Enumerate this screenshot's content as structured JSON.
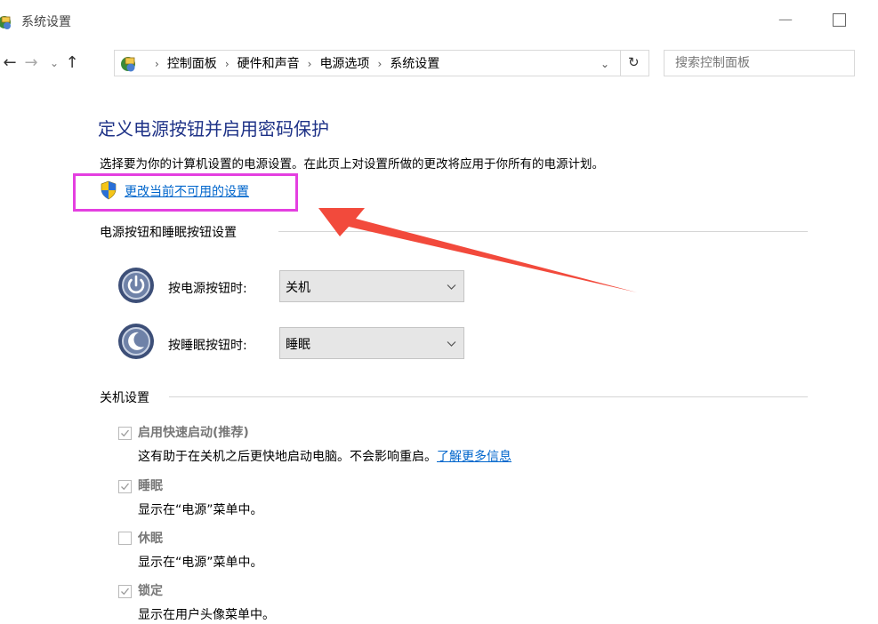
{
  "window": {
    "title": "系统设置",
    "minimize_symbol": "—"
  },
  "nav": {
    "back_icon": "←",
    "forward_icon": "→",
    "recent_icon": "⌄",
    "up_icon": "↑",
    "breadcrumbs": [
      "控制面板",
      "硬件和声音",
      "电源选项",
      "系统设置"
    ],
    "separator": "›",
    "dropdown_icon": "⌄",
    "refresh_icon": "↻",
    "search_placeholder": "搜索控制面板"
  },
  "main": {
    "title": "定义电源按钮并启用密码保护",
    "description": "选择要为你的计算机设置的电源设置。在此页上对设置所做的更改将应用于你所有的电源计划。",
    "change_link": "更改当前不可用的设置",
    "highlight_color": "#e43fe0",
    "arrow_color": "#f24a3c"
  },
  "power_section": {
    "heading": "电源按钮和睡眠按钮设置",
    "rows": [
      {
        "label": "按电源按钮时:",
        "value": "关机",
        "icon": "power-icon"
      },
      {
        "label": "按睡眠按钮时:",
        "value": "睡眠",
        "icon": "sleep-icon"
      }
    ]
  },
  "shutdown_section": {
    "heading": "关机设置",
    "options": [
      {
        "label": "启用快速启动(推荐)",
        "checked": true,
        "desc": "这有助于在关机之后更快地启动电脑。不会影响重启。",
        "link": "了解更多信息"
      },
      {
        "label": "睡眠",
        "checked": true,
        "desc": "显示在“电源”菜单中。"
      },
      {
        "label": "休眠",
        "checked": false,
        "desc": "显示在“电源”菜单中。"
      },
      {
        "label": "锁定",
        "checked": true,
        "desc": "显示在用户头像菜单中。"
      }
    ]
  },
  "colors": {
    "title_blue": "#1e3287",
    "link_blue": "#0066cc"
  }
}
